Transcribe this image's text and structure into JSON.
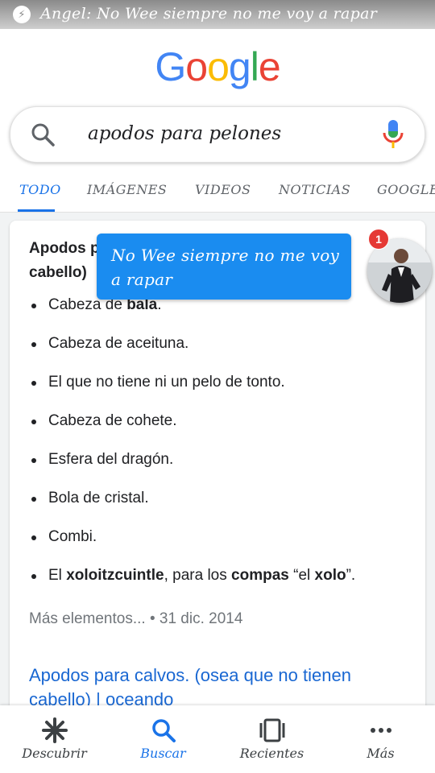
{
  "notification": {
    "text": "Angel: No Wee siempre no me voy a rapar"
  },
  "logo": {
    "text": "Google",
    "letters": [
      "G",
      "o",
      "o",
      "g",
      "l",
      "e"
    ],
    "colors": [
      "#4285f4",
      "#ea4335",
      "#fbbc05",
      "#4285f4",
      "#34a853",
      "#ea4335"
    ]
  },
  "search": {
    "query": "apodos para pelones"
  },
  "tabs": [
    {
      "label": "TODO",
      "active": true
    },
    {
      "label": "IMÁGENES"
    },
    {
      "label": "VIDEOS"
    },
    {
      "label": "NOTICIAS"
    },
    {
      "label": "GOOGLE"
    }
  ],
  "card": {
    "heading_line1": "Apodos p",
    "heading_line2": "cabello)",
    "bullets": [
      [
        {
          "t": "Cabeza de "
        },
        {
          "t": "bala",
          "b": true
        },
        {
          "t": "."
        }
      ],
      [
        {
          "t": "Cabeza de aceituna."
        }
      ],
      [
        {
          "t": "El que no tiene ni un pelo de tonto."
        }
      ],
      [
        {
          "t": "Cabeza de cohete."
        }
      ],
      [
        {
          "t": "Esfera del dragón."
        }
      ],
      [
        {
          "t": "Bola de cristal."
        }
      ],
      [
        {
          "t": "Combi."
        }
      ],
      [
        {
          "t": "El "
        },
        {
          "t": "xoloitzcuintle",
          "b": true
        },
        {
          "t": ", para los "
        },
        {
          "t": "compas",
          "b": true
        },
        {
          "t": " “el "
        },
        {
          "t": "xolo",
          "b": true
        },
        {
          "t": "”."
        }
      ]
    ],
    "meta": "Más elementos... • 31 dic. 2014",
    "result_link": "Apodos para calvos. (osea que no tienen cabello) | oceando"
  },
  "chat_bubble": {
    "text": "No Wee siempre no me voy a rapar"
  },
  "chathead": {
    "badge": "1"
  },
  "bottom_nav": [
    {
      "label": "Descubrir",
      "icon": "asterisk-icon"
    },
    {
      "label": "Buscar",
      "icon": "search-icon",
      "active": true
    },
    {
      "label": "Recientes",
      "icon": "recents-icon"
    },
    {
      "label": "Más",
      "icon": "more-dots-icon"
    }
  ],
  "colors": {
    "accent": "#1a73e8",
    "bubble": "#1a8cf0",
    "badge": "#e53935",
    "link": "#1967d2"
  }
}
